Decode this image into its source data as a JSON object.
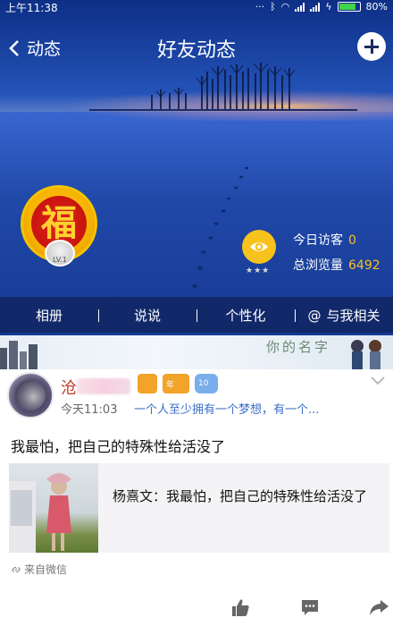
{
  "status_bar": {
    "time": "上午11:38",
    "battery": "80%"
  },
  "nav": {
    "back_label": "动态",
    "title": "好友动态"
  },
  "profile": {
    "avatar_char": "福",
    "level": "LV.1",
    "today_visitors_label": "今日访客",
    "today_visitors": "0",
    "total_views_label": "总浏览量",
    "total_views": "6492"
  },
  "tabs": [
    {
      "label": "相册"
    },
    {
      "label": "说说"
    },
    {
      "label": "个性化"
    },
    {
      "label": "与我相关"
    }
  ],
  "banner": {
    "text": "你的名字"
  },
  "post": {
    "author_initial": "沧",
    "badges": [
      "",
      "年",
      "10"
    ],
    "time": "今天11:03",
    "signature": "一个人至少拥有一个梦想，有一个...",
    "text": "我最怕，把自己的特殊性给活没了",
    "shared_text": "杨熹文：我最怕，把自己的特殊性给活没了",
    "source": "来自微信"
  },
  "colors": {
    "accent_yellow": "#f7c21b",
    "number_yellow": "#ffbf1f",
    "link_blue": "#3a6ec8"
  }
}
